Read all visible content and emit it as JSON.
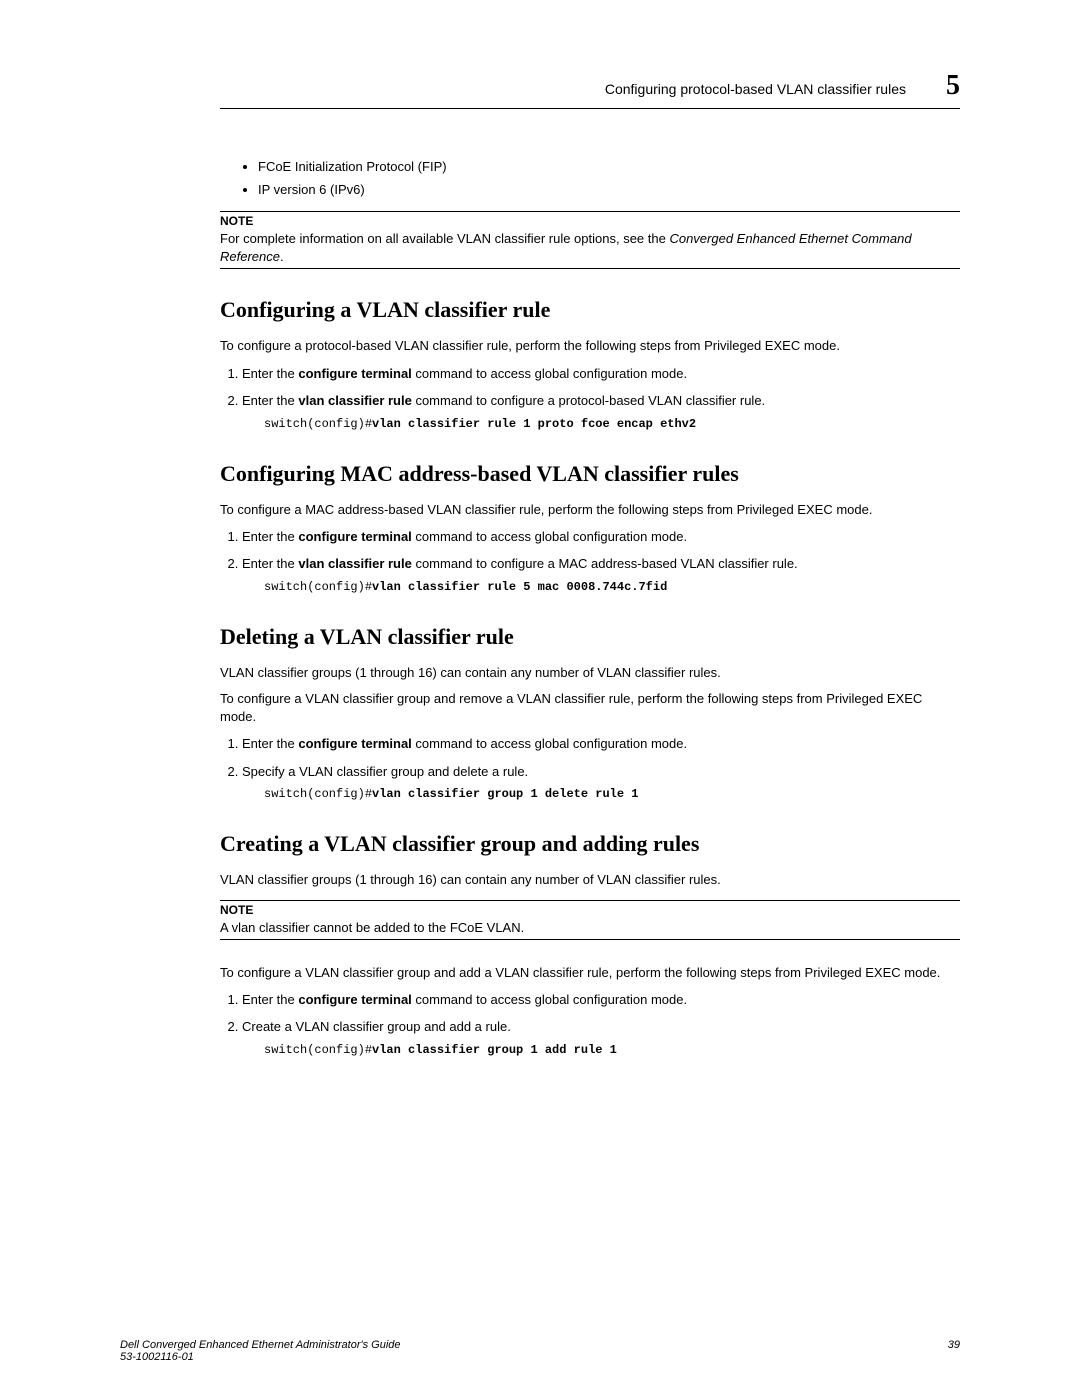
{
  "header": {
    "title": "Configuring protocol-based VLAN classifier rules",
    "chapter": "5"
  },
  "intro_bullets": [
    "FCoE Initialization Protocol (FIP)",
    "IP version 6 (IPv6)"
  ],
  "note1": {
    "label": "NOTE",
    "text_pre": "For complete information on all available VLAN classifier rule options, see the ",
    "text_em": "Converged Enhanced Ethernet Command Reference",
    "text_post": "."
  },
  "section1": {
    "heading": "Configuring a VLAN classifier rule",
    "intro": "To configure a protocol-based VLAN classifier rule, perform the following steps from Privileged EXEC mode.",
    "step1_pre": "Enter the ",
    "step1_b": "configure terminal",
    "step1_post": " command to access global configuration mode.",
    "step2_pre": "Enter the ",
    "step2_b": "vlan classifier rule",
    "step2_post": " command to configure a protocol-based VLAN classifier rule.",
    "code_prompt": "switch(config)#",
    "code_cmd": "vlan classifier rule 1 proto fcoe encap ethv2"
  },
  "section2": {
    "heading": "Configuring MAC address-based VLAN classifier rules",
    "intro": "To configure a MAC address-based VLAN classifier rule, perform the following steps from Privileged EXEC mode.",
    "step1_pre": "Enter the ",
    "step1_b": "configure terminal",
    "step1_post": " command to access global configuration mode.",
    "step2_pre": "Enter the ",
    "step2_b": "vlan classifier rule",
    "step2_post": " command to configure a MAC address-based VLAN classifier rule.",
    "code_prompt": "switch(config)#",
    "code_cmd": "vlan classifier rule 5 mac 0008.744c.7fid"
  },
  "section3": {
    "heading": "Deleting a VLAN classifier rule",
    "p1": "VLAN classifier groups (1 through 16) can contain any number of VLAN classifier rules.",
    "p2": "To configure a VLAN classifier group and remove a VLAN classifier rule, perform the following steps from Privileged EXEC mode.",
    "step1_pre": "Enter the ",
    "step1_b": "configure terminal",
    "step1_post": " command to access global configuration mode.",
    "step2": "Specify a VLAN classifier group and delete a rule.",
    "code_prompt": "switch(config)#",
    "code_cmd": "vlan classifier group 1 delete rule 1"
  },
  "section4": {
    "heading": "Creating a VLAN classifier group and adding rules",
    "p1": "VLAN classifier groups (1 through 16) can contain any number of VLAN classifier rules.",
    "note": {
      "label": "NOTE",
      "text": "A vlan classifier cannot be added to the FCoE VLAN."
    },
    "p2": "To configure a VLAN classifier group and add a VLAN classifier rule, perform the following steps from Privileged EXEC mode.",
    "step1_pre": "Enter the ",
    "step1_b": "configure terminal",
    "step1_post": " command to access global configuration mode.",
    "step2": "Create a VLAN classifier group and add a rule.",
    "code_prompt": "switch(config)#",
    "code_cmd": "vlan classifier group 1 add rule 1"
  },
  "footer": {
    "line1": "Dell Converged Enhanced Ethernet Administrator's Guide",
    "line2": "53-1002116-01",
    "page": "39"
  }
}
